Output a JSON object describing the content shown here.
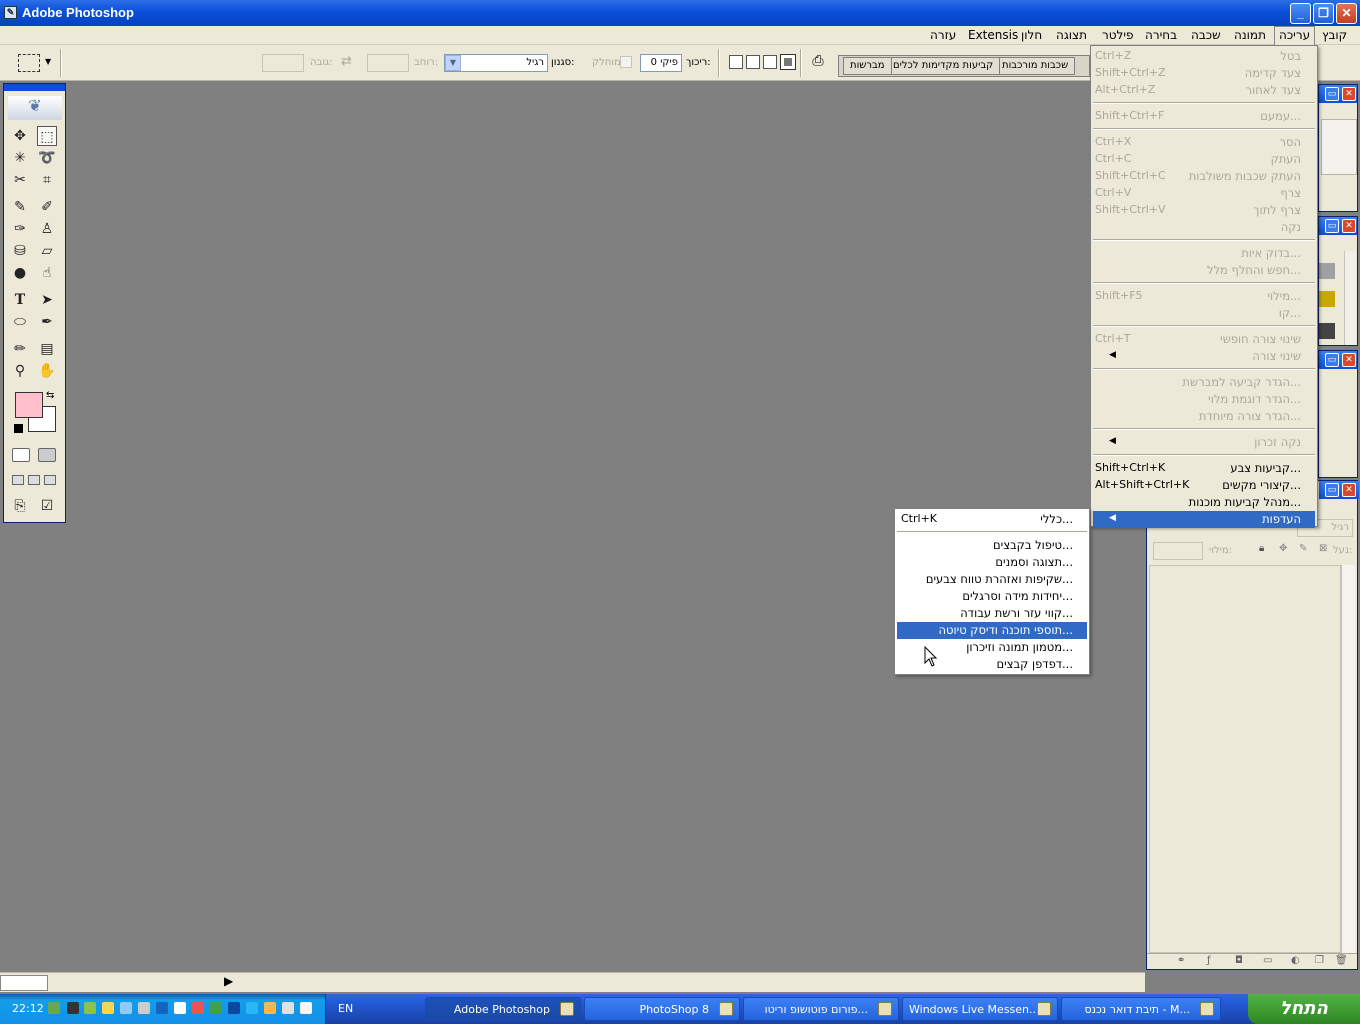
{
  "window": {
    "title": "Adobe Photoshop",
    "minimize": "_",
    "restore": "❐",
    "close": "✕"
  },
  "menubar": [
    "קובץ",
    "עריכה",
    "תמונה",
    "שכבה",
    "בחירה",
    "תצוגה",
    "פילטר",
    "חלון",
    "Extensis",
    "עזרה"
  ],
  "options": {
    "feather_label": "ריכוך:",
    "feather_value": "0 פיקי",
    "antialias_label": "מוחלק",
    "style_label": "סגנון:",
    "style_value": "רגיל",
    "width_label": "רוחב:",
    "height_label": "גובה:",
    "palette_tabs": [
      "מברשות",
      "קביעות מקדימות לכלים",
      "שכבות מורכבות"
    ]
  },
  "edit_menu": [
    {
      "label": "בטל",
      "shortcut": "Ctrl+Z",
      "enabled": false
    },
    {
      "label": "צעד קדימה",
      "shortcut": "Shift+Ctrl+Z",
      "enabled": false
    },
    {
      "label": "צעד לאחור",
      "shortcut": "Alt+Ctrl+Z",
      "enabled": false
    },
    {
      "sep": true
    },
    {
      "label": "עמעם...",
      "shortcut": "Shift+Ctrl+F",
      "enabled": false
    },
    {
      "sep": true
    },
    {
      "label": "הסר",
      "shortcut": "Ctrl+X",
      "enabled": false
    },
    {
      "label": "העתק",
      "shortcut": "Ctrl+C",
      "enabled": false
    },
    {
      "label": "העתק שכבות משולבות",
      "shortcut": "Shift+Ctrl+C",
      "enabled": false
    },
    {
      "label": "צרף",
      "shortcut": "Ctrl+V",
      "enabled": false
    },
    {
      "label": "צרף לתוך",
      "shortcut": "Shift+Ctrl+V",
      "enabled": false
    },
    {
      "label": "נקה",
      "shortcut": "",
      "enabled": false
    },
    {
      "sep": true
    },
    {
      "label": "בדוק איות...",
      "shortcut": "",
      "enabled": false
    },
    {
      "label": "חפש והחלף מלל...",
      "shortcut": "",
      "enabled": false
    },
    {
      "sep": true
    },
    {
      "label": "מילוי...",
      "shortcut": "Shift+F5",
      "enabled": false
    },
    {
      "label": "קו...",
      "shortcut": "",
      "enabled": false
    },
    {
      "sep": true
    },
    {
      "label": "שינוי צורה חופשי",
      "shortcut": "Ctrl+T",
      "enabled": false
    },
    {
      "label": "שינוי צורה",
      "shortcut": "",
      "enabled": false,
      "submenu": true
    },
    {
      "sep": true
    },
    {
      "label": "הגדר קביעה למברשת...",
      "shortcut": "",
      "enabled": false
    },
    {
      "label": "הגדר דוגמת מלוי...",
      "shortcut": "",
      "enabled": false
    },
    {
      "label": "הגדר צורה מיוחדת...",
      "shortcut": "",
      "enabled": false
    },
    {
      "sep": true
    },
    {
      "label": "נקה זכרון",
      "shortcut": "",
      "enabled": false,
      "submenu": true
    },
    {
      "sep": true
    },
    {
      "label": "קביעות צבע...",
      "shortcut": "Shift+Ctrl+K",
      "enabled": true
    },
    {
      "label": "קיצורי מקשים...",
      "shortcut": "Alt+Shift+Ctrl+K",
      "enabled": true
    },
    {
      "label": "מנהל קביעות מוכנות...",
      "shortcut": "",
      "enabled": true
    },
    {
      "label": "העדפות",
      "shortcut": "",
      "enabled": true,
      "submenu": true,
      "highlight": true
    }
  ],
  "prefs_menu": [
    {
      "label": "כללי...",
      "shortcut": "Ctrl+K"
    },
    {
      "sep": true
    },
    {
      "label": "טיפול בקבצים..."
    },
    {
      "label": "תצוגה וסמנים..."
    },
    {
      "label": "שקיפות ואזהרת טווח צבעים..."
    },
    {
      "label": "יחידות מידה וסרגלים..."
    },
    {
      "label": "קווי עזר ורשת עבודה..."
    },
    {
      "label": "תוספי תוכנה ודיסק טיוטה...",
      "highlight": true
    },
    {
      "label": "מטמון תמונה וזיכרון..."
    },
    {
      "label": "דפדפן קבצים..."
    }
  ],
  "layers_panel": {
    "mode": "רגיל",
    "lock_label": "נעל:",
    "fill_label": "מילוי:"
  },
  "taskbar": {
    "start": "התחל",
    "clock": "22:12",
    "lang": "EN",
    "buttons": [
      {
        "label": "תיבת דואר נכנס - M...",
        "active": false
      },
      {
        "label": "Windows Live Messen...",
        "active": false
      },
      {
        "label": "פורום פוטושופ וריטו...",
        "active": false
      },
      {
        "label": "PhotoShop 8",
        "active": false
      },
      {
        "label": "Adobe Photoshop",
        "active": true
      }
    ]
  }
}
